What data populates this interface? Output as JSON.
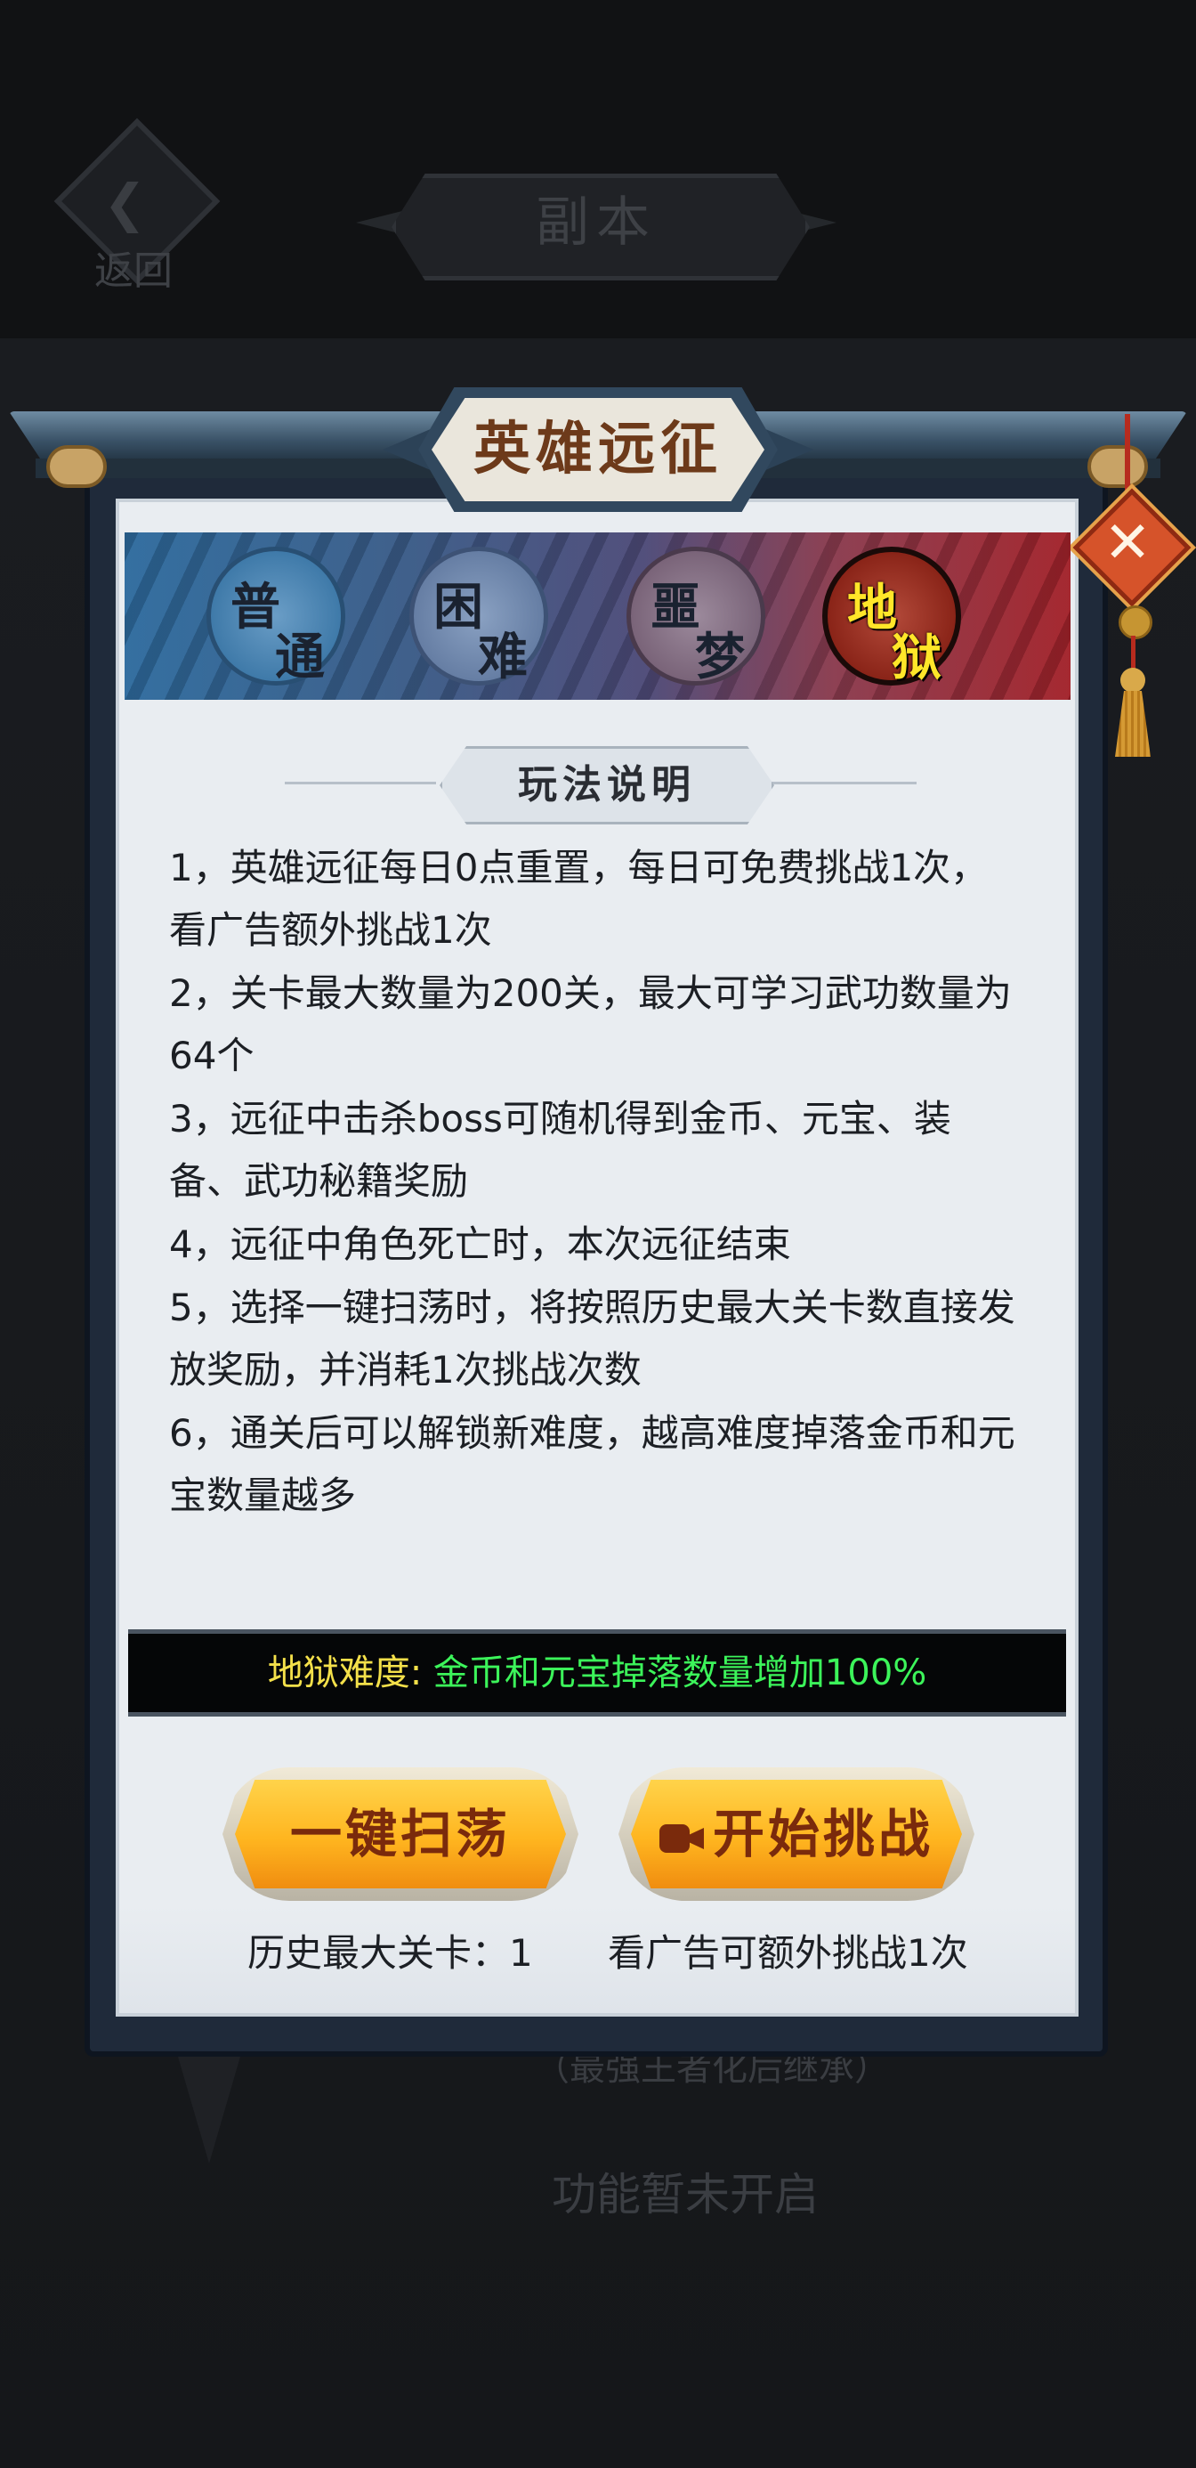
{
  "header": {
    "back_label": "返回",
    "title": "副本"
  },
  "background": {
    "subtitle_fragment": "（最强王者化后继承）",
    "locked_text": "功能暂未开启"
  },
  "dialog": {
    "title": "英雄远征",
    "close_icon": "close-x-icon",
    "difficulty_tabs": [
      {
        "char1": "普",
        "char2": "通",
        "label": "普通",
        "selected": false
      },
      {
        "char1": "困",
        "char2": "难",
        "label": "困难",
        "selected": false
      },
      {
        "char1": "噩",
        "char2": "梦",
        "label": "噩梦",
        "selected": false
      },
      {
        "char1": "地",
        "char2": "狱",
        "label": "地狱",
        "selected": true
      }
    ],
    "section_title": "玩法说明",
    "rules": [
      "1，英雄远征每日0点重置，每日可免费挑战1次，看广告额外挑战1次",
      "2，关卡最大数量为200关，最大可学习武功数量为64个",
      "3，远征中击杀boss可随机得到金币、元宝、装备、武功秘籍奖励",
      "4，远征中角色死亡时，本次远征结束",
      "5，选择一键扫荡时，将按照历史最大关卡数直接发放奖励，并消耗1次挑战次数",
      "6，通关后可以解锁新难度，越高难度掉落金币和元宝数量越多"
    ],
    "bonus": {
      "label": "地狱难度: ",
      "value": "金币和元宝掉落数量增加100%",
      "label_color": "#f4e04a",
      "value_color": "#3cf45a"
    },
    "buttons": {
      "sweep_label": "一键扫荡",
      "start_label": "开始挑战",
      "start_icon": "video-camera-icon"
    },
    "captions": {
      "history_max": "历史最大关卡：1",
      "ad_extra": "看广告可额外挑战1次"
    }
  }
}
